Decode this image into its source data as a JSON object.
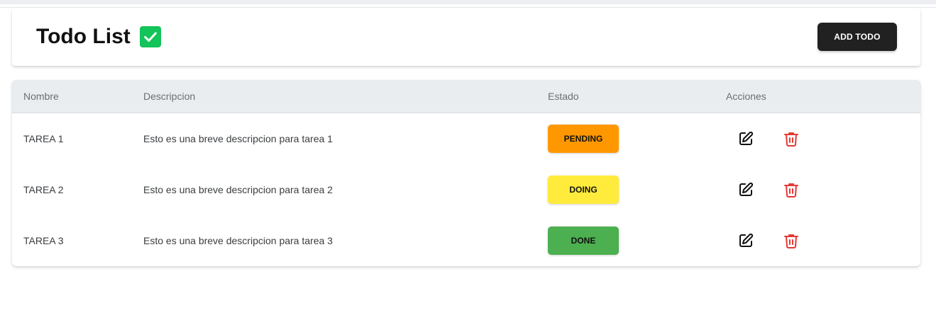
{
  "header": {
    "title": "Todo List",
    "title_icon": "check-square-icon",
    "add_button_label": "ADD TODO"
  },
  "table": {
    "columns": [
      "Nombre",
      "Descripcion",
      "Estado",
      "Acciones"
    ],
    "rows": [
      {
        "name": "TAREA 1",
        "description": "Esto es una breve descripcion para tarea 1",
        "status": "PENDING",
        "status_color": "#ff9800"
      },
      {
        "name": "TAREA 2",
        "description": "Esto es una breve descripcion para tarea 2",
        "status": "DOING",
        "status_color": "#ffeb3b"
      },
      {
        "name": "TAREA 3",
        "description": "Esto es una breve descripcion para tarea 3",
        "status": "DONE",
        "status_color": "#4caf50"
      }
    ],
    "action_icons": [
      "edit-icon",
      "trash-icon"
    ]
  },
  "colors": {
    "check_green": "#12c45a",
    "button_dark": "#212121",
    "delete_red": "#e53935",
    "header_bg": "#e9edf0"
  }
}
